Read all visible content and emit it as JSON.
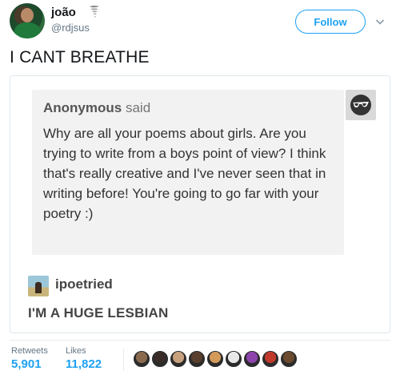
{
  "tweet": {
    "display_name": "joão",
    "name_emoji_icon": "tornado-icon",
    "handle": "@rdjsus",
    "follow_label": "Follow",
    "text": "I CANT BREATHE"
  },
  "ask": {
    "asker": "Anonymous",
    "said": "said",
    "question": "Why are all your poems about girls. Are you trying to write from a boys point of view? I think that's really creative and I've never seen that in writing before! You're going to go far with your poetry :)",
    "answerer": "ipoetried",
    "answer": "I'M A HUGE LESBIAN"
  },
  "stats": {
    "retweets_label": "Retweets",
    "retweets_value": "5,901",
    "likes_label": "Likes",
    "likes_value": "11,822"
  },
  "likers_colors": [
    "#8a6a4e",
    "#3a2c28",
    "#c7a07e",
    "#5a3e2e",
    "#d49a5a",
    "#e8e8e8",
    "#8e44ad",
    "#c0392b",
    "#6b4a2f"
  ],
  "colors": {
    "accent": "#1da1f2"
  }
}
